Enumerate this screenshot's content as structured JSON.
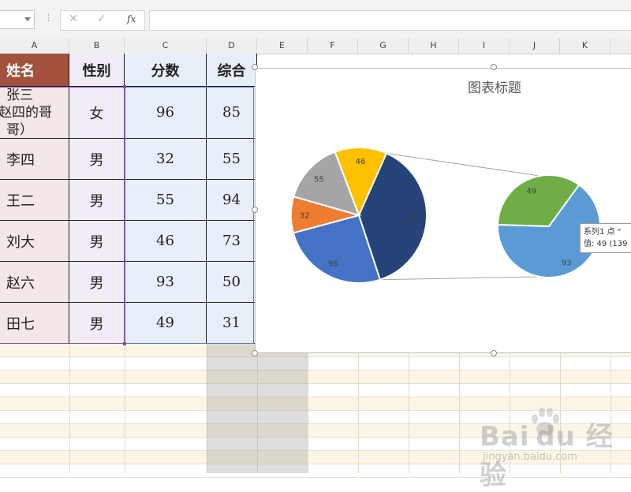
{
  "formula_bar": {
    "cancel_icon": "close-icon",
    "enter_icon": "check-icon",
    "fx_label": "fx",
    "formula_value": ""
  },
  "columns": [
    "A",
    "B",
    "C",
    "D",
    "E",
    "F",
    "G",
    "H",
    "I",
    "J",
    "K"
  ],
  "table": {
    "headers": [
      "姓名",
      "性别",
      "分数",
      "综合"
    ],
    "rows": [
      {
        "name": "张三\n（赵四的哥哥）",
        "gender": "女",
        "score": "96",
        "total": "85"
      },
      {
        "name": "李四",
        "gender": "男",
        "score": "32",
        "total": "55"
      },
      {
        "name": "王二",
        "gender": "男",
        "score": "55",
        "total": "94"
      },
      {
        "name": "刘大",
        "gender": "男",
        "score": "46",
        "total": "73"
      },
      {
        "name": "赵六",
        "gender": "男",
        "score": "93",
        "total": "50"
      },
      {
        "name": "田七",
        "gender": "男",
        "score": "49",
        "total": "31"
      }
    ]
  },
  "name_row0_lines": [
    "张三",
    "赵四的哥",
    "哥）"
  ],
  "chart": {
    "title": "图表标题",
    "tooltip_line1": "系列1 点 \"",
    "tooltip_line2": "值: 49 (139",
    "colors": {
      "dark_blue": "#264478",
      "blue": "#4472c4",
      "orange": "#ed7d31",
      "gray": "#a5a5a5",
      "gold": "#ffc000",
      "light_blue": "#5b9bd5",
      "green": "#70ad47"
    }
  },
  "chart_data": {
    "type": "pie",
    "title": "图表标题",
    "subtype": "pie-of-pie",
    "primary": [
      {
        "label": "142",
        "value": 142,
        "color": "#264478"
      },
      {
        "label": "96",
        "value": 96,
        "color": "#4472c4"
      },
      {
        "label": "32",
        "value": 32,
        "color": "#ed7d31"
      },
      {
        "label": "55",
        "value": 55,
        "color": "#a5a5a5"
      },
      {
        "label": "46",
        "value": 46,
        "color": "#ffc000"
      }
    ],
    "secondary": [
      {
        "label": "93",
        "value": 93,
        "color": "#5b9bd5"
      },
      {
        "label": "49",
        "value": 49,
        "color": "#70ad47"
      }
    ]
  },
  "watermark": {
    "logo": "Bai du 经验",
    "url": "jingyan.baidu.com"
  }
}
